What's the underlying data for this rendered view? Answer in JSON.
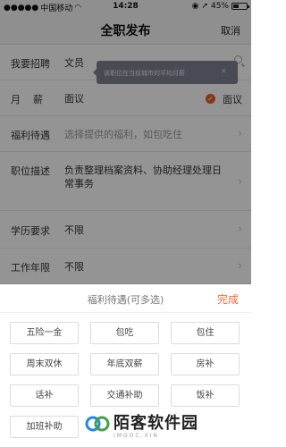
{
  "status_bar": {
    "carrier": "中国移动",
    "time": "14:28",
    "battery": "45%",
    "battery_level": 0.45
  },
  "nav": {
    "title": "全职发布",
    "cancel_label": "取消"
  },
  "form": {
    "rows": [
      {
        "label": "我要招聘",
        "value": "文员"
      },
      {
        "label": "月薪",
        "value": "面议",
        "right_option": "面议"
      },
      {
        "label": "福利待遇",
        "placeholder": "选择提供的福利，如包吃住"
      },
      {
        "label": "职位描述",
        "value": "负责整理档案资料、协助经理处理日常事务"
      },
      {
        "label": "学历要求",
        "value": "不限"
      },
      {
        "label": "工作年限",
        "value": "不限"
      }
    ]
  },
  "tooltip": {
    "text": "该职位在当前城市的平均月薪",
    "close": "×"
  },
  "sheet": {
    "title": "福利待遇(可多选)",
    "done_label": "完成",
    "options": [
      "五险一金",
      "包吃",
      "包住",
      "周末双休",
      "年底双薪",
      "房补",
      "话补",
      "交通补助",
      "饭补",
      "加班补助"
    ]
  },
  "watermark": {
    "title": "陌客软件园",
    "subtitle": "IMOOC.XIN"
  },
  "colors": {
    "accent": "#ef6b3a",
    "check": "#e8602c",
    "tooltip_bg": "#7c8291"
  }
}
